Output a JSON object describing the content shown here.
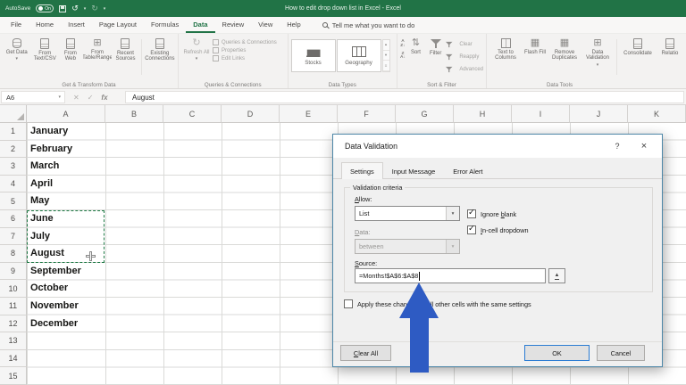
{
  "colors": {
    "excel_green": "#217346",
    "arrow_blue": "#2E5BC3",
    "ok_border": "#2B7CD3"
  },
  "icons": {
    "caret_down": "▾",
    "check": "✓",
    "cancel_x": "✕",
    "close": "×",
    "help": "?",
    "undo": "↺",
    "redo": "↻",
    "refresh": "↻",
    "table_glyph": "⊞",
    "grid_glyph": "▦",
    "sort_glyph": "⇅",
    "fx": "fx",
    "collapse": "▲",
    "scroll_up": "▴",
    "scroll_down": "▾",
    "menu_lines": "≡"
  },
  "titlebar": {
    "autosave_label": "AutoSave",
    "autosave_state": "On",
    "title": "How to edit drop down list in Excel  -  Excel"
  },
  "menu": {
    "tabs": [
      "File",
      "Home",
      "Insert",
      "Page Layout",
      "Formulas",
      "Data",
      "Review",
      "View",
      "Help"
    ],
    "active_index": 5,
    "tell_me": "Tell me what you want to do"
  },
  "ribbon": {
    "get_transform": {
      "label": "Get & Transform Data",
      "items": [
        {
          "label": "Get Data"
        },
        {
          "label": "From Text/CSV"
        },
        {
          "label": "From Web"
        },
        {
          "label": "From Table/Range"
        },
        {
          "label": "Recent Sources"
        },
        {
          "label": "Existing Connections"
        }
      ]
    },
    "queries": {
      "label": "Queries & Connections",
      "refresh": "Refresh All",
      "items": [
        "Queries & Connections",
        "Properties",
        "Edit Links"
      ]
    },
    "data_types": {
      "label": "Data Types",
      "items": [
        "Stocks",
        "Geography"
      ]
    },
    "sort_filter": {
      "label": "Sort & Filter",
      "sort": "Sort",
      "filter": "Filter",
      "side": [
        "Clear",
        "Reapply",
        "Advanced"
      ]
    },
    "data_tools": {
      "label": "Data Tools",
      "items": [
        "Text to Columns",
        "Flash Fill",
        "Remove Duplicates",
        "Data Validation",
        "Consolidate",
        "Relatio"
      ]
    }
  },
  "formula_bar": {
    "name_box": "A6",
    "value": "August"
  },
  "sheet": {
    "columns": [
      "A",
      "B",
      "C",
      "D",
      "E",
      "F",
      "G",
      "H",
      "I",
      "J",
      "K"
    ],
    "row_labels": [
      "1",
      "2",
      "3",
      "4",
      "5",
      "6",
      "7",
      "8",
      "9",
      "10",
      "11",
      "12",
      "13",
      "14",
      "15"
    ],
    "months": [
      "January",
      "February",
      "March",
      "April",
      "May",
      "June",
      "July",
      "August",
      "September",
      "October",
      "November",
      "December"
    ],
    "selected_cell": "A6",
    "marquee_range": "A6:A8"
  },
  "dialog": {
    "title": "Data Validation",
    "help": "?",
    "close": "×",
    "tabs": [
      "Settings",
      "Input Message",
      "Error Alert"
    ],
    "group_label": "Validation criteria",
    "allow": {
      "u": "A",
      "rest": "llow:"
    },
    "allow_value": "List",
    "ignore_blank": {
      "pre": "Ignore ",
      "u": "b",
      "rest": "lank"
    },
    "in_cell": {
      "u": "I",
      "rest": "n-cell dropdown"
    },
    "data": {
      "u": "D",
      "rest": "ata:"
    },
    "data_value": "between",
    "source": {
      "u": "S",
      "rest": "ource:"
    },
    "source_value": "=Months!$A$6:$A$8",
    "apply_label": "Apply these changes to all other cells with the same settings",
    "clear_all": {
      "u": "C",
      "rest": "lear All"
    },
    "ok": "OK",
    "cancel": "Cancel"
  }
}
